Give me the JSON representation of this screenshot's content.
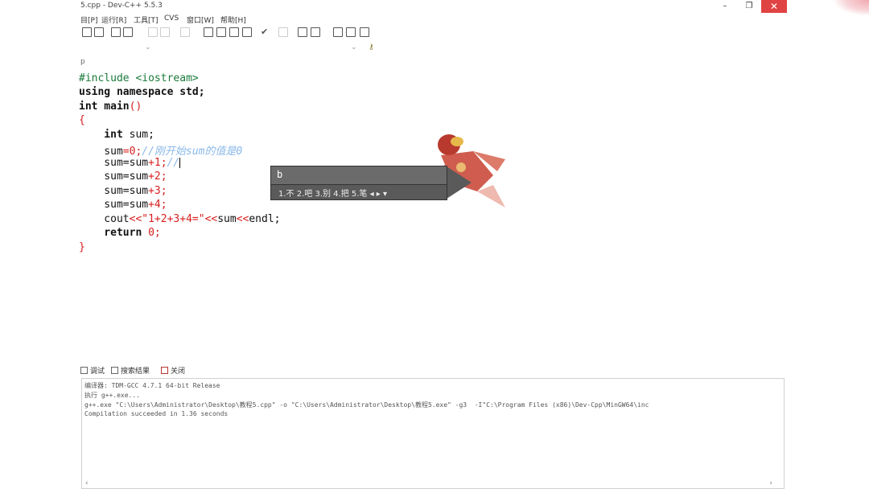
{
  "window": {
    "title": "5.cpp - Dev-C++ 5.5.3",
    "minimize_glyph": "–",
    "maximize_glyph": "❐",
    "close_glyph": "✕",
    "close_color": "#e04343"
  },
  "menu": [
    "目[P]",
    "运行[R]",
    "工具[T]",
    "CVS",
    "窗口[W]",
    "帮助[H]"
  ],
  "editor": {
    "gutter_label": "p",
    "lines": {
      "l1": {
        "a": "#include ",
        "b": "<iostream>"
      },
      "l2": {
        "a": "using namespace std;"
      },
      "l3": {
        "a": "int main",
        "b": "()"
      },
      "l4": {
        "a": "{"
      },
      "l5": {
        "a": "    int ",
        "b": "sum;"
      },
      "l6": {
        "a": "    sum",
        "b": "=0;",
        "c": "//刚开始sum的值是0"
      },
      "l7": {
        "a": "    sum=sum",
        "b": "+1;",
        "c": "//"
      },
      "l8": {
        "a": "    sum=sum",
        "b": "+2;"
      },
      "l9": {
        "a": "    sum=sum",
        "b": "+3;"
      },
      "l10": {
        "a": "    sum=sum",
        "b": "+4;"
      },
      "l11": {
        "a": "    cout",
        "b": "<<",
        "c": "\"1+2+3+4=\"",
        "d": "<<",
        "e": "sum",
        "f": "<<",
        "g": "endl;"
      },
      "l12": {
        "a": "    return ",
        "b": "0;"
      },
      "l13": {
        "a": "}"
      }
    },
    "colors": {
      "keyword": "#111111",
      "number_operator": "#d81e1e",
      "preprocessor": "#1a7a3a",
      "comment": "#8ab8e8"
    }
  },
  "ime": {
    "input": "b",
    "candidates": "1.不  2.吧  3.别  4.把  5.笔 ◂ ▸ ▾"
  },
  "bottom_tabs": {
    "debug": "调试",
    "search": "搜索结果",
    "close": "关闭"
  },
  "output": {
    "l1": "编译器: TDM-GCC 4.7.1 64-bit Release",
    "l2": "执行 g++.exe...",
    "l3": "g++.exe \"C:\\Users\\Administrator\\Desktop\\教程5.cpp\" -o \"C:\\Users\\Administrator\\Desktop\\教程5.exe\" -g3  -I\"C:\\Program Files (x86)\\Dev-Cpp\\MinGW64\\inc",
    "l4": "Compilation succeeded in 1.36 seconds",
    "scroll_left": "‹",
    "scroll_right": "›"
  }
}
